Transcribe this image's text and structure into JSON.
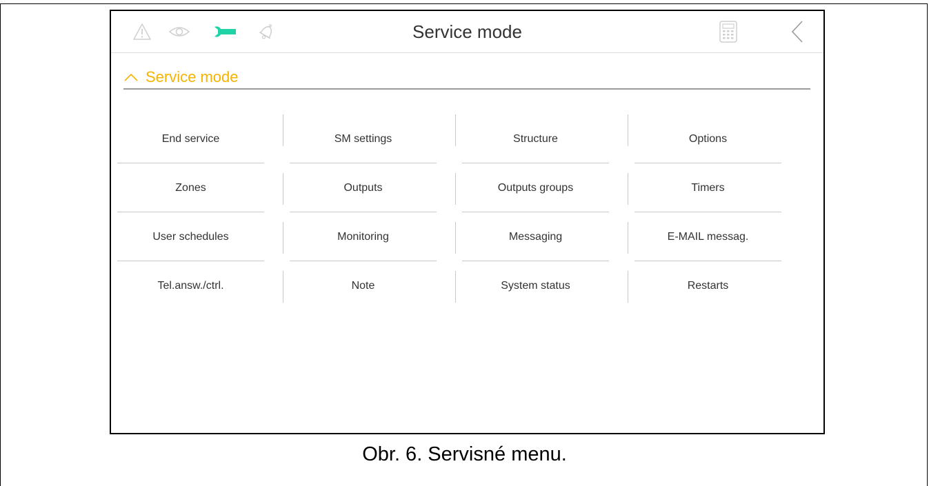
{
  "topbar": {
    "title": "Service mode",
    "icons": [
      "warning-icon",
      "eye-icon",
      "wrench-icon",
      "bell-icon",
      "keypad-icon",
      "back-chevron-icon"
    ],
    "active_color": "#1fd3a6",
    "inactive_color": "#cfcfcf"
  },
  "section": {
    "label": "Service mode",
    "accent_color": "#f5b400"
  },
  "menu": {
    "rows": [
      [
        "End service",
        "SM settings",
        "Structure",
        "Options"
      ],
      [
        "Zones",
        "Outputs",
        "Outputs groups",
        "Timers"
      ],
      [
        "User schedules",
        "Monitoring",
        "Messaging",
        "E-MAIL messag."
      ],
      [
        "Tel.answ./ctrl.",
        "Note",
        "System status",
        "Restarts"
      ]
    ]
  },
  "caption": "Obr. 6. Servisné menu."
}
